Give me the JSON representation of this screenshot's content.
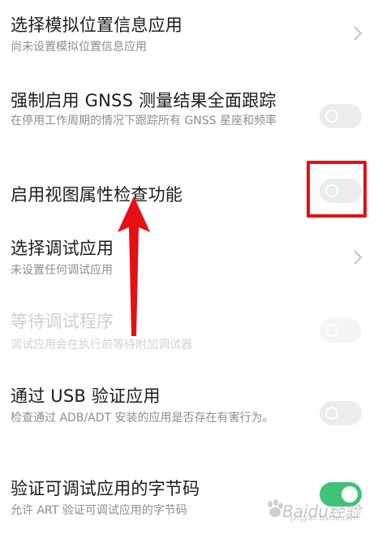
{
  "settings": {
    "items": [
      {
        "title": "选择模拟位置信息应用",
        "subtitle": "尚未设置模拟位置信息应用",
        "control": "chevron",
        "enabled": true
      },
      {
        "title": "强制启用 GNSS 测量结果全面跟踪",
        "subtitle": "在停用工作周期的情况下跟踪所有 GNSS 星座和频率",
        "control": "toggle",
        "checked": false,
        "enabled": true
      },
      {
        "title": "启用视图属性检查功能",
        "subtitle": "",
        "control": "toggle",
        "checked": false,
        "enabled": true,
        "highlighted": true
      },
      {
        "title": "选择调试应用",
        "subtitle": "未设置任何调试应用",
        "control": "chevron",
        "enabled": true
      },
      {
        "title": "等待调试程序",
        "subtitle": "调试应用会在执行前等待附加调试器",
        "control": "toggle",
        "checked": false,
        "enabled": false
      },
      {
        "title": "通过 USB 验证应用",
        "subtitle": "检查通过 ADB/ADT 安装的应用是否存在有害行为。",
        "control": "toggle",
        "checked": false,
        "enabled": true
      },
      {
        "title": "验证可调试应用的字节码",
        "subtitle": "允许 ART 验证可调试应用的字节码",
        "control": "toggle",
        "checked": true,
        "enabled": true
      }
    ]
  },
  "annotations": {
    "highlight_color": "#e50f14",
    "arrow_color": "#e50f14"
  },
  "watermark": {
    "text": "Baidu经验",
    "small_text": "jingyan.baidu.com"
  },
  "colors": {
    "title": "#1c1c1c",
    "subtitle": "#8e8e8e",
    "toggle_off": "#ececec",
    "toggle_on": "#3dc476"
  }
}
